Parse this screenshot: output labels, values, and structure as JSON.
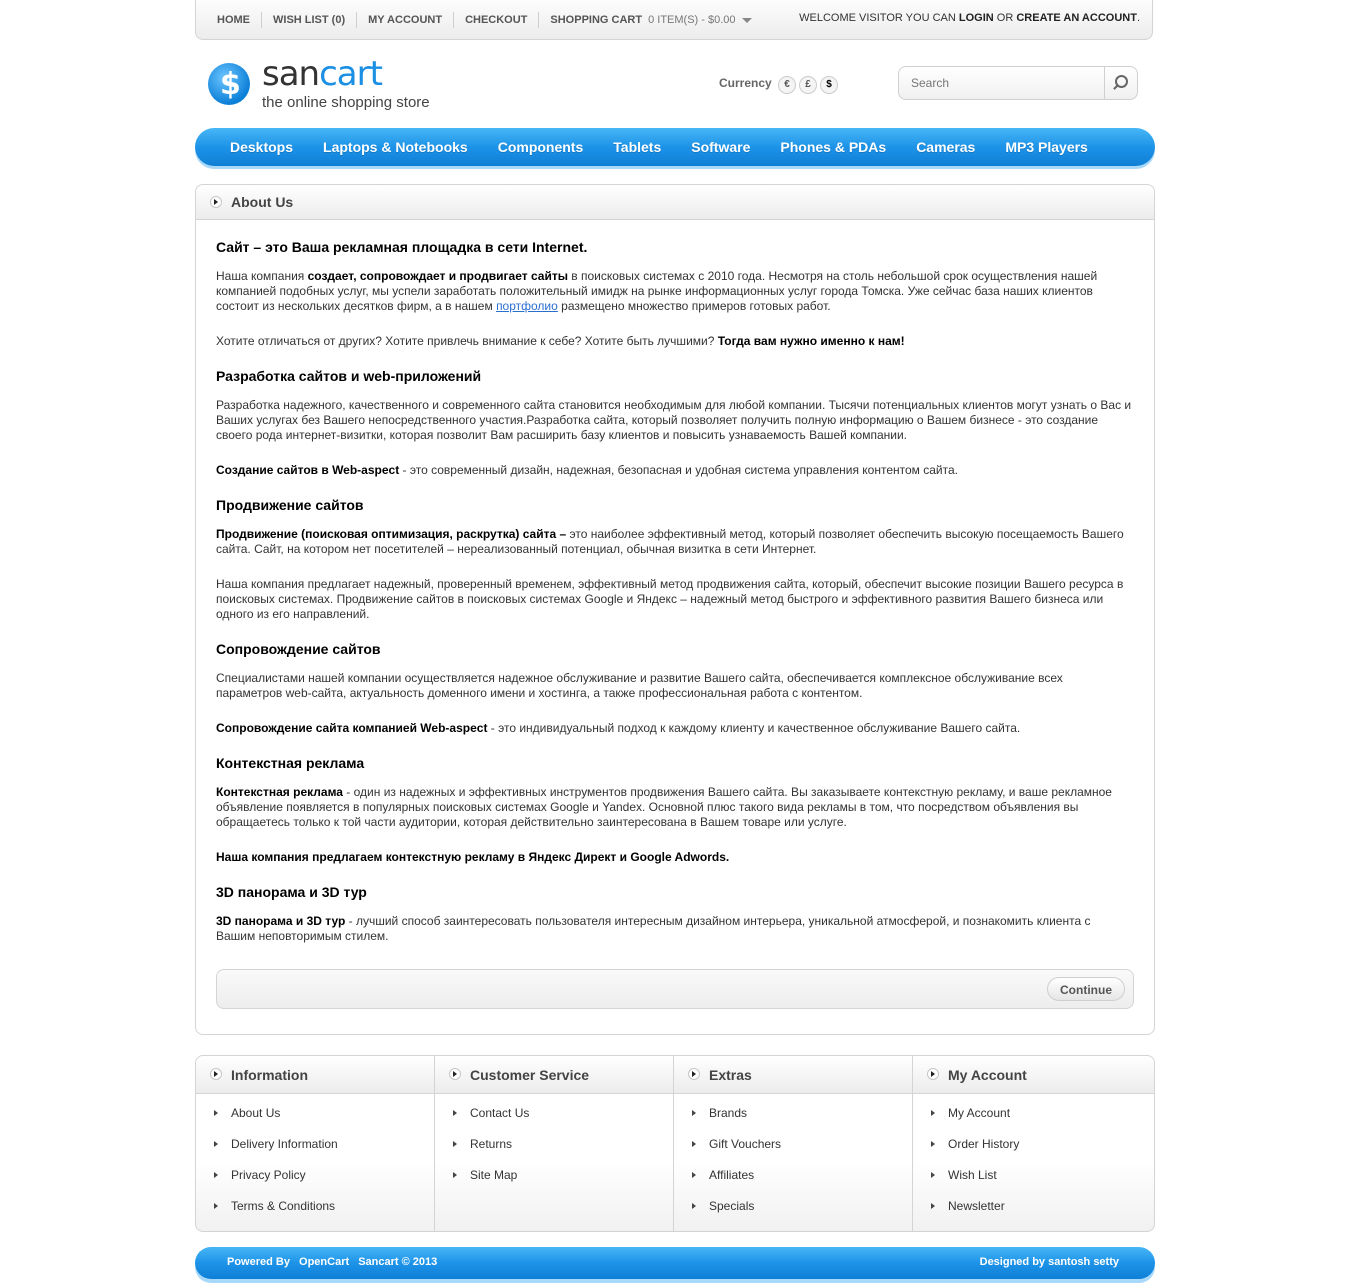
{
  "topbar": {
    "links": [
      "HOME",
      "WISH LIST (0)",
      "MY ACCOUNT",
      "CHECKOUT"
    ],
    "cart_label": "SHOPPING CART",
    "cart_status": "0 ITEM(S) - $0.00",
    "welcome_prefix": "WELCOME VISITOR YOU CAN",
    "login": "LOGIN",
    "or": "OR",
    "create_account": "CREATE AN ACCOUNT",
    "period": "."
  },
  "logo": {
    "name_1": "san",
    "name_2": "cart",
    "tagline": "the online shopping store"
  },
  "currency": {
    "label": "Currency",
    "options": [
      "€",
      "£",
      "$"
    ],
    "selected": "$"
  },
  "search": {
    "placeholder": "Search"
  },
  "menu": [
    "Desktops",
    "Laptops & Notebooks",
    "Components",
    "Tablets",
    "Software",
    "Phones & PDAs",
    "Cameras",
    "MP3 Players"
  ],
  "content": {
    "title": "About Us",
    "h_intro": "Сайт – это Ваша рекламная площадка в сети Internet.",
    "p1_a": "Наша компания ",
    "p1_b": "создает, сопровождает и продвигает сайты",
    "p1_c": " в поисковых системах с  2010 года. Несмотря на столь небольшой срок осуществления нашей компанией подобных услуг, мы успели заработать положительный имидж на рынке информационных услуг города Томска. Уже сейчас база наших клиентов состоит из нескольких десятков фирм, а в нашем ",
    "p1_link": "портфолио",
    "p1_d": " размещено множество примеров готовых работ.",
    "p2_a": "Хотите отличаться от других? Хотите привлечь внимание к себе? Хотите быть лучшими? ",
    "p2_b": "Тогда вам нужно именно к нам!",
    "h_dev": "Разработка сайтов и web-приложений",
    "p3": "Разработка надежного, качественного и современного сайта становится необходимым для любой компании. Тысячи потенциальных клиентов могут узнать о Вас и Ваших услугах без Вашего непосредственного участия.Разработка сайта, который позволяет получить полную информацию о Вашем бизнесе - это создание своего рода интернет-визитки, которая позволит Вам расширить базу клиентов и  повысить узнаваемость Вашей компании.",
    "p4_a": "Создание сайтов в Web-aspect",
    "p4_b": " - это современный дизайн, надежная, безопасная и удобная система управления контентом сайта.",
    "h_promo": "Продвижение сайтов",
    "p5_a": "Продвижение (поисковая оптимизация, раскрутка) сайта –",
    "p5_b": " это наиболее эффективный метод, который позволяет обеспечить высокую посещаемость Вашего сайта. Сайт, на котором нет посетителей – нереализованный потенциал, обычная визитка в сети Интернет.",
    "p6": "Наша компания предлагает надежный, проверенный временем, эффективный метод продвижения сайта, который, обеспечит высокие позиции Вашего ресурса в поисковых системах. Продвижение сайтов в поисковых системах Google и Яндекс – надежный метод быстрого и эффективного развития Вашего бизнеса или одного из его направлений.",
    "h_support": "Сопровождение сайтов",
    "p7": "Специалистами нашей компании осуществляется надежное обслуживание и развитие Вашего сайта, обеспечивается комплексное обслуживание всех параметров web-сайта, актуальность доменного имени и хостинга, а также профессиональная работа с контентом.",
    "p8_a": "Сопровождение сайта компанией Web-aspect",
    "p8_b": " - это индивидуальный подход к каждому клиенту и качественное обслуживание Вашего сайта.",
    "h_ads": "Контекстная реклама",
    "p9_a": "Контекстная реклама",
    "p9_b": " - один из надежных и эффективных инструментов продвижения Вашего сайта. Вы заказываете контекстную рекламу, и ваше рекламное объявление появляется в популярных поисковых системах Google и Yandex. Основной плюс такого вида рекламы в том, что посредством объявления вы обращаетесь только к той части аудитории, которая действительно заинтересована в Вашем товаре или услуге.",
    "p10": "Наша компания предлагаем контекстную рекламу в Яндекс Директ и Google Adwords.",
    "h_3d": "3D панорама и 3D тур",
    "p11_a": "3D панорама и 3D тур",
    "p11_b": " - лучший способ заинтересовать пользователя интересным дизайном интерьера, уникальной атмосферой, и познакомить клиента с Вашим неповторимым стилем.",
    "continue": "Continue"
  },
  "footer": {
    "columns": [
      {
        "title": "Information",
        "links": [
          "About Us",
          "Delivery Information",
          "Privacy Policy",
          "Terms & Conditions"
        ]
      },
      {
        "title": "Customer Service",
        "links": [
          "Contact Us",
          "Returns",
          "Site Map"
        ]
      },
      {
        "title": "Extras",
        "links": [
          "Brands",
          "Gift Vouchers",
          "Affiliates",
          "Specials"
        ]
      },
      {
        "title": "My Account",
        "links": [
          "My Account",
          "Order History",
          "Wish List",
          "Newsletter"
        ]
      }
    ]
  },
  "bottombar": {
    "powered_by": "Powered By",
    "opencart": "OpenCart",
    "sancart": "Sancart © 2013",
    "designed": "Designed by santosh setty"
  },
  "colors": {
    "accent": "#1d93e8",
    "link": "#2a6fd0"
  }
}
